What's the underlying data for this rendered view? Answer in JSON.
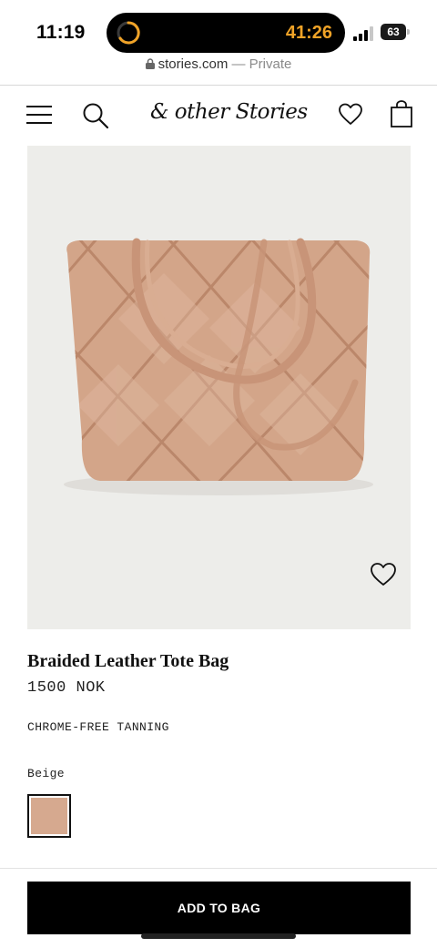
{
  "status_bar": {
    "time": "11:19",
    "timer": "41:26",
    "battery": "63",
    "timer_color": "#f0a327"
  },
  "browser": {
    "domain": "stories.com",
    "separator": " — ",
    "private_label": "Private"
  },
  "header": {
    "logo_text": "& other Stories",
    "icons": [
      "menu-icon",
      "search-icon",
      "heart-icon",
      "shopping-bag-icon"
    ]
  },
  "product": {
    "name": "Braided Leather Tote Bag",
    "price": "1500 NOK",
    "feature": "CHROME-FREE TANNING",
    "color_label": "Beige",
    "swatch_color": "#d6a98f",
    "image_background": "#ededea"
  },
  "cta": {
    "add_to_bag_label": "ADD TO BAG"
  }
}
